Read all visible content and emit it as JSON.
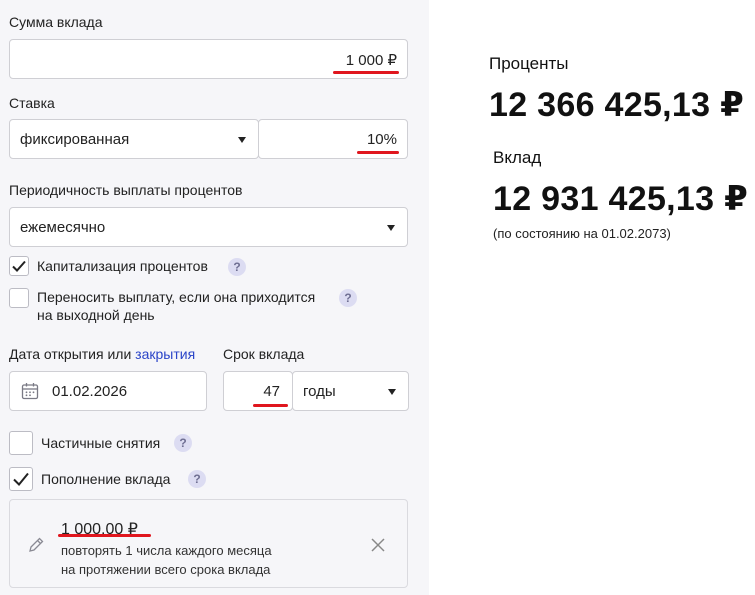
{
  "deposit_amount": {
    "label": "Сумма вклада",
    "value": "1 000 ₽"
  },
  "rate": {
    "label": "Ставка",
    "type_value": "фиксированная",
    "value": "10%"
  },
  "payout_frequency": {
    "label": "Периодичность выплаты процентов",
    "value": "ежемесячно"
  },
  "capitalization": {
    "label": "Капитализация процентов",
    "checked": true
  },
  "holiday_transfer": {
    "label_line1": "Переносить выплату, если она приходится",
    "label_line2": "на выходной день",
    "checked": false
  },
  "open_date": {
    "label_prefix": "Дата открытия или",
    "label_link": "закрытия",
    "value": "01.02.2026"
  },
  "term": {
    "label": "Срок вклада",
    "value": "47",
    "unit": "годы"
  },
  "partial_withdrawals": {
    "label": "Частичные снятия",
    "checked": false
  },
  "replenishment": {
    "label": "Пополнение вклада",
    "checked": true,
    "card": {
      "amount": "1 000,00 ₽",
      "line1": "повторять 1 числа каждого месяца",
      "line2": "на протяжении всего срока вклада"
    }
  },
  "help_glyph": "?",
  "icons": [
    "chevron-down-icon",
    "calendar-icon",
    "checkmark-icon",
    "question-icon",
    "pencil-icon",
    "close-icon"
  ],
  "accent_colors": {
    "underline": "#e0161e",
    "link": "#2a44c8",
    "help_badge": "#dcdcf2"
  },
  "results": {
    "interest_label": "Проценты",
    "interest_value": "12 366 425,13 ₽",
    "deposit_label": "Вклад",
    "deposit_value": "12 931 425,13 ₽",
    "as_of": "(по состоянию на 01.02.2073)"
  }
}
